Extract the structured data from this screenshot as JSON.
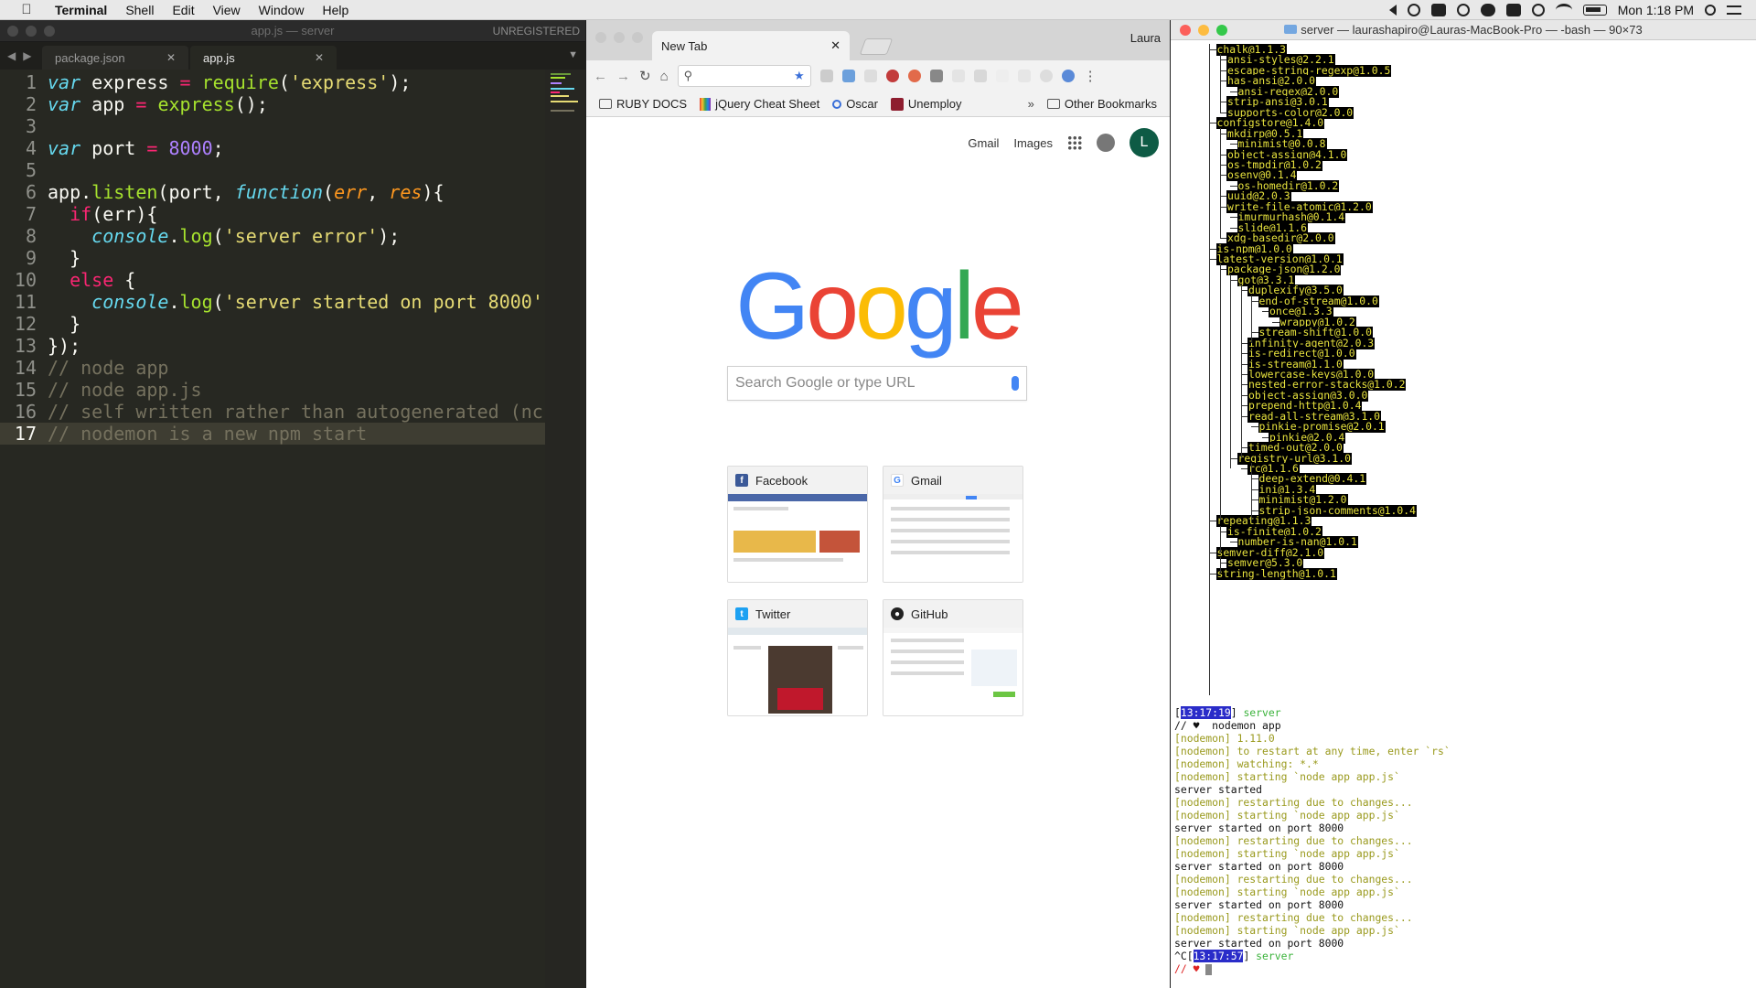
{
  "menubar": {
    "app": "Terminal",
    "items": [
      "Shell",
      "Edit",
      "View",
      "Window",
      "Help"
    ],
    "clock": "Mon 1:18 PM"
  },
  "editor": {
    "title": "app.js — server",
    "unregistered": "UNREGISTERED",
    "tabs": [
      {
        "label": "package.json",
        "active": false
      },
      {
        "label": "app.js",
        "active": true
      }
    ],
    "current_line": 17
  },
  "browser": {
    "tab_title": "New Tab",
    "profile": "Laura",
    "bookmarks": [
      "RUBY DOCS",
      "jQuery Cheat Sheet",
      "Oscar",
      "Unemploy"
    ],
    "other_bookmarks": "Other Bookmarks",
    "more": "»",
    "top_links": {
      "gmail": "Gmail",
      "images": "Images",
      "avatar": "L"
    },
    "logo": "Google",
    "search_placeholder": "Search Google or type URL",
    "tiles": [
      {
        "label": "Facebook",
        "icon": "facebook-icon",
        "color": "#3b5998"
      },
      {
        "label": "Gmail",
        "icon": "google-icon",
        "color": "#ffffff"
      },
      {
        "label": "Twitter",
        "icon": "twitter-icon",
        "color": "#1da1f2"
      },
      {
        "label": "GitHub",
        "icon": "github-icon",
        "color": "#222222"
      }
    ]
  },
  "terminal": {
    "title": "server — laurashapiro@Lauras-MacBook-Pro — -bash — 90×73",
    "tree_packages": [
      "chalk@1.1.3",
      "ansi-styles@2.2.1",
      "escape-string-regexp@1.0.5",
      "has-ansi@2.0.0",
      "ansi-regex@2.0.0",
      "strip-ansi@3.0.1",
      "supports-color@2.0.0",
      "configstore@1.4.0",
      "mkdirp@0.5.1",
      "minimist@0.0.8",
      "object-assign@4.1.0",
      "os-tmpdir@1.0.2",
      "osenv@0.1.4",
      "os-homedir@1.0.2",
      "uuid@2.0.3",
      "write-file-atomic@1.2.0",
      "imurmurhash@0.1.4",
      "slide@1.1.6",
      "xdg-basedir@2.0.0",
      "is-npm@1.0.0",
      "latest-version@1.0.1",
      "package-json@1.2.0",
      "got@3.3.1",
      "duplexify@3.5.0",
      "end-of-stream@1.0.0",
      "once@1.3.3",
      "wrappy@1.0.2",
      "stream-shift@1.0.0",
      "infinity-agent@2.0.3",
      "is-redirect@1.0.0",
      "is-stream@1.1.0",
      "lowercase-keys@1.0.0",
      "nested-error-stacks@1.0.2",
      "object-assign@3.0.0",
      "prepend-http@1.0.4",
      "read-all-stream@3.1.0",
      "pinkie-promise@2.0.1",
      "pinkie@2.0.4",
      "timed-out@2.0.0",
      "registry-url@3.1.0",
      "rc@1.1.6",
      "deep-extend@0.4.1",
      "ini@1.3.4",
      "minimist@1.2.0",
      "strip-json-comments@1.0.4",
      "repeating@1.1.3",
      "is-finite@1.0.2",
      "number-is-nan@1.0.1",
      "semver-diff@2.1.0",
      "semver@5.3.0",
      "string-length@1.0.1"
    ],
    "prompt1": {
      "time": "13:17:19",
      "dir": "server"
    },
    "command": "// ♥  nodemon app",
    "log": [
      {
        "text": "[nodemon] 1.11.0",
        "kind": "nm"
      },
      {
        "text": "[nodemon] to restart at any time, enter `rs`",
        "kind": "nm"
      },
      {
        "text": "[nodemon] watching: *.*",
        "kind": "nm"
      },
      {
        "text": "[nodemon] starting `node app app.js`",
        "kind": "nm"
      },
      {
        "text": "server started",
        "kind": "out"
      },
      {
        "text": "[nodemon] restarting due to changes...",
        "kind": "nm"
      },
      {
        "text": "[nodemon] starting `node app app.js`",
        "kind": "nm"
      },
      {
        "text": "server started on port 8000",
        "kind": "out"
      },
      {
        "text": "[nodemon] restarting due to changes...",
        "kind": "nm"
      },
      {
        "text": "[nodemon] starting `node app app.js`",
        "kind": "nm"
      },
      {
        "text": "server started on port 8000",
        "kind": "out"
      },
      {
        "text": "[nodemon] restarting due to changes...",
        "kind": "nm"
      },
      {
        "text": "[nodemon] starting `node app app.js`",
        "kind": "nm"
      },
      {
        "text": "server started on port 8000",
        "kind": "out"
      },
      {
        "text": "[nodemon] restarting due to changes...",
        "kind": "nm"
      },
      {
        "text": "[nodemon] starting `node app app.js`",
        "kind": "nm"
      },
      {
        "text": "server started on port 8000",
        "kind": "out"
      }
    ],
    "prompt2": {
      "prefix": "^C",
      "time": "13:17:57",
      "dir": "server"
    },
    "last_prompt": "// ♥ "
  }
}
